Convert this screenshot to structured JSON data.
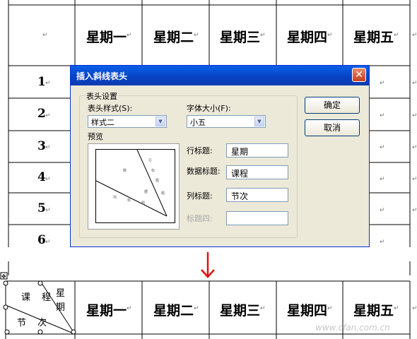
{
  "top_table": {
    "header_days": [
      "星期一",
      "星期二",
      "星期三",
      "星期四",
      "星期五"
    ],
    "row_numbers": [
      "1",
      "2",
      "3",
      "4",
      "5",
      "6"
    ]
  },
  "dialog": {
    "title": "插入斜线表头",
    "group_label": "表头设置",
    "style_label": "表头样式(S):",
    "style_value": "样式二",
    "font_label": "字体大小(F):",
    "font_value": "小五",
    "preview_label": "预览",
    "preview_marks": [
      "行",
      "标",
      "数",
      "题",
      "列",
      "据",
      "题",
      "标",
      "题"
    ],
    "row_title_label": "行标题:",
    "row_title_value": "星期",
    "data_title_label": "数据标题:",
    "data_title_value": "课程",
    "col_title_label": "列标题:",
    "col_title_value": "节次",
    "title4_label": "标题四:",
    "title4_value": "",
    "ok_label": "确定",
    "cancel_label": "取消"
  },
  "arrow_color": "#e01010",
  "bottom_table": {
    "diag_row": "星期",
    "diag_data": "课程",
    "diag_col": "节次",
    "header_days": [
      "星期一",
      "星期二",
      "星期三",
      "星期四",
      "星期五"
    ]
  },
  "watermark": "www.cfan.com.cn"
}
